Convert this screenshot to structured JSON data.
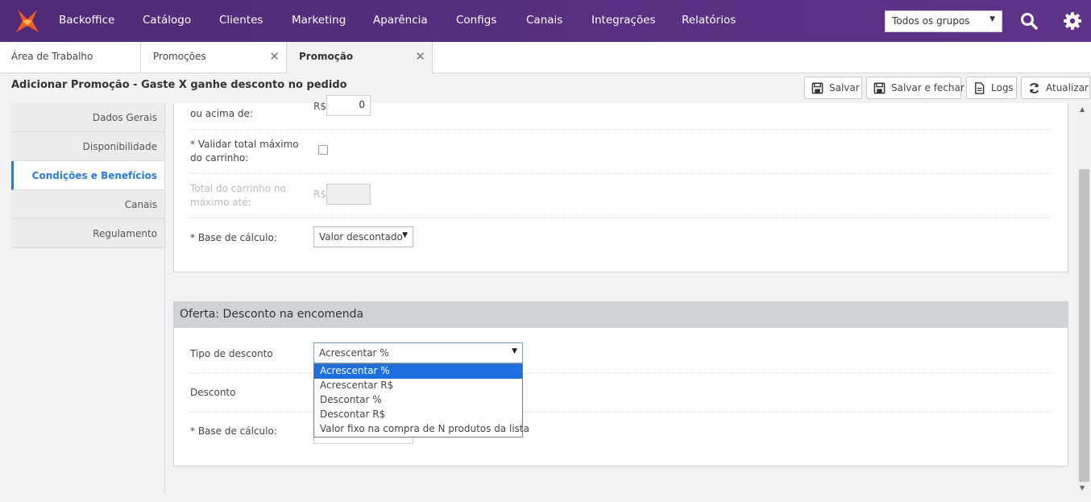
{
  "nav": {
    "items": [
      "Backoffice",
      "Catálogo",
      "Clientes",
      "Marketing",
      "Aparência",
      "Configs",
      "Canais",
      "Integrações",
      "Relatórios"
    ],
    "group_select": "Todos os grupos"
  },
  "tabs": [
    {
      "label": "Área de Trabalho"
    },
    {
      "label": "Promoções"
    },
    {
      "label": "Promoção"
    }
  ],
  "page": {
    "title": "Adicionar Promoção - Gaste X ganhe desconto no pedido",
    "buttons": {
      "save": "Salvar",
      "save_close": "Salvar e fechar",
      "logs": "Logs",
      "refresh": "Atualizar"
    }
  },
  "sidebar": {
    "items": [
      "Dados Gerais",
      "Disponibilidade",
      "Condições e Benefícios",
      "Canais",
      "Regulamento"
    ],
    "active": "Condições e Benefícios"
  },
  "conditions": {
    "min_total_label": "ou acima de:",
    "min_total_currency": "R$",
    "min_total_value": "0",
    "validate_max_label": "* Validar total máximo do carrinho:",
    "max_total_label": "Total do carrinho no máximo até:",
    "max_total_currency": "R$",
    "calc_base_label": "* Base de cálculo:",
    "calc_base_value": "Valor descontado"
  },
  "offer": {
    "title": "Oferta: Desconto na encomenda",
    "discount_type_label": "Tipo de desconto",
    "discount_type_value": "Acrescentar %",
    "discount_label": "Desconto",
    "calc_base_label": "* Base de cálculo:",
    "options": [
      "Acrescentar %",
      "Acrescentar R$",
      "Descontar %",
      "Descontar R$",
      "Valor fixo na compra de N produtos da lista"
    ]
  },
  "colors": {
    "topbar": "#5b2f82",
    "accent": "#2a7bd4",
    "selected_option": "#1e70e0"
  }
}
